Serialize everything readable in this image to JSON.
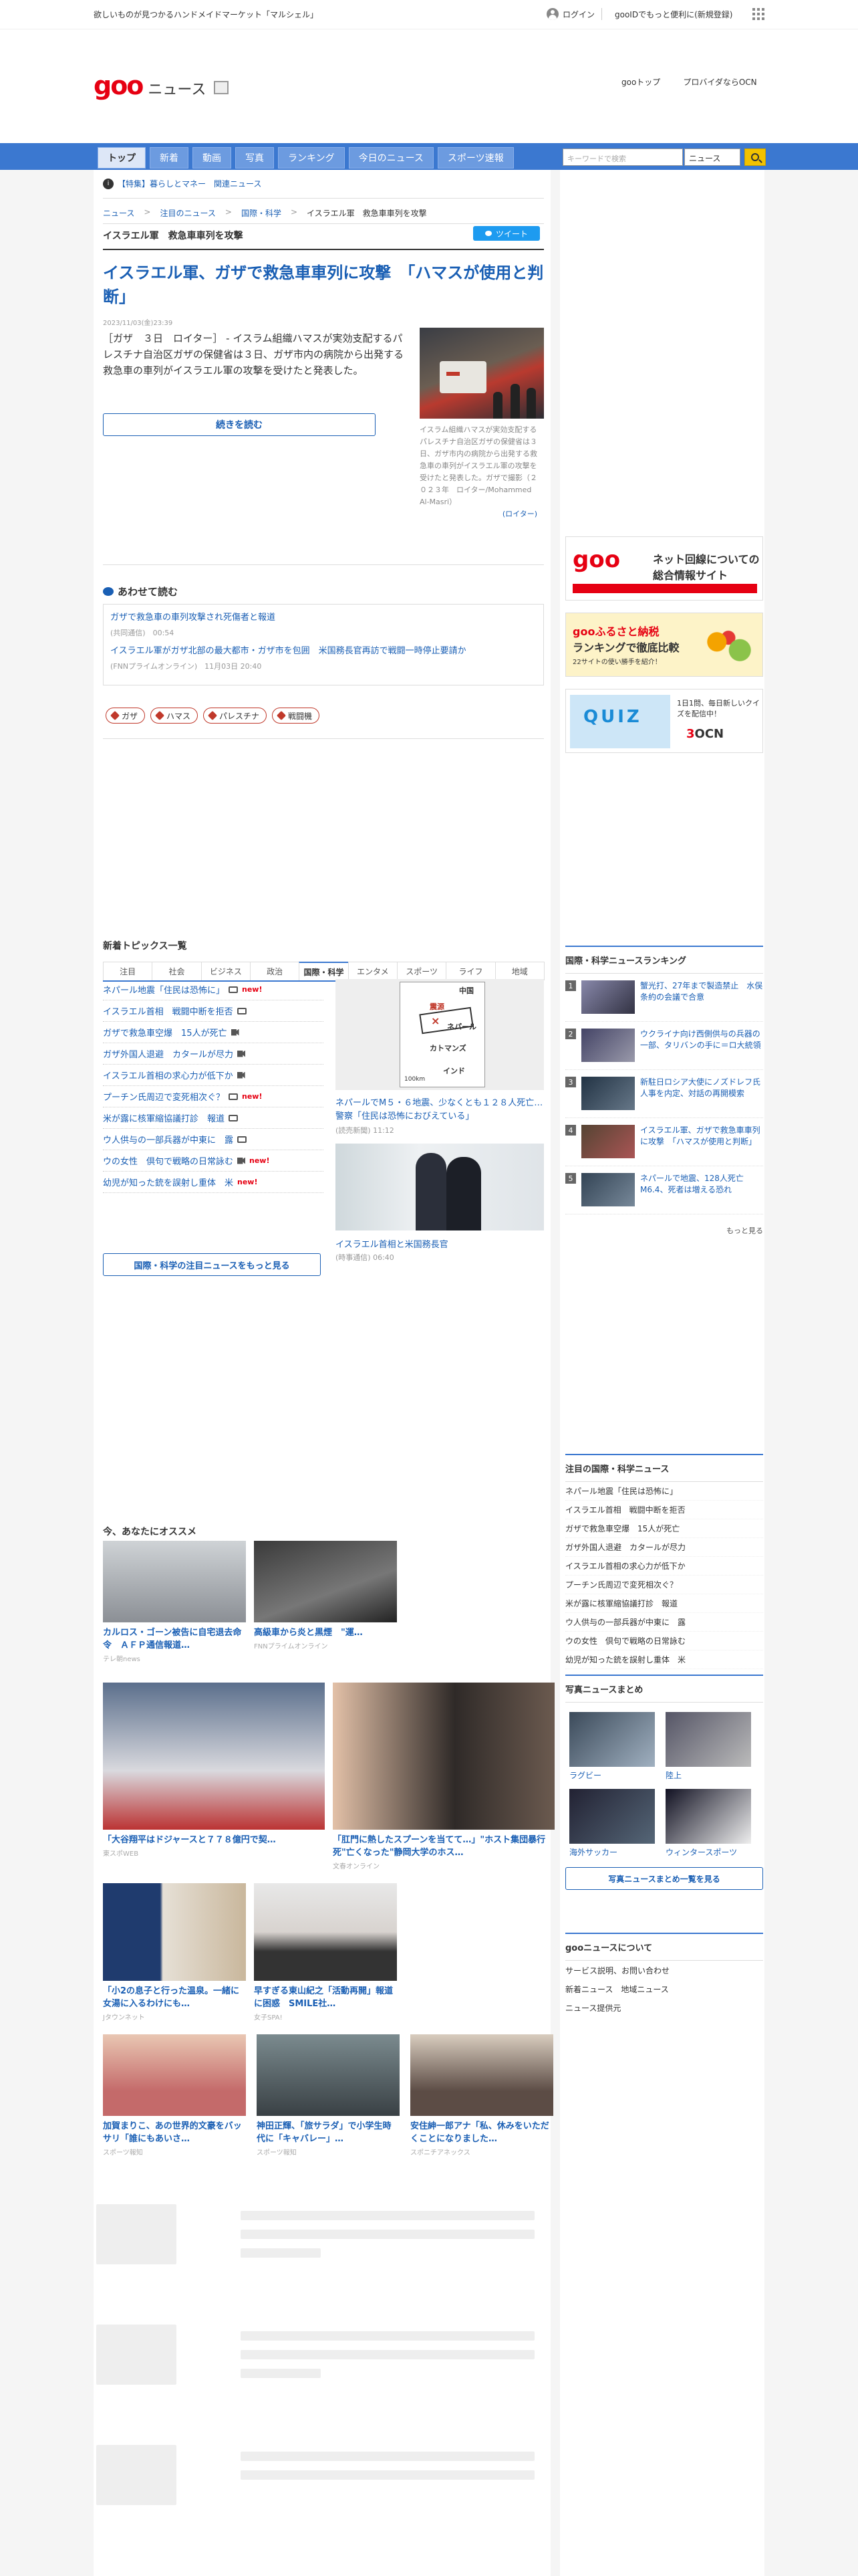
{
  "topbar": {
    "tagline": "欲しいものが見つかるハンドメイドマーケット「マルシェル」",
    "login": "ログイン",
    "promo": "gooIDでもっと便利に(新規登録)"
  },
  "header": {
    "logo_goo": "goo",
    "logo_news": "ニュース",
    "links": [
      "gooトップ",
      "プロバイダならOCN"
    ]
  },
  "nav": {
    "tabs": [
      "トップ",
      "新着",
      "動画",
      "写真",
      "ランキング",
      "今日のニュース",
      "スポーツ速報"
    ],
    "active_tab": "トップ",
    "search_placeholder": "キーワードで検索",
    "search_scope": "ニュース"
  },
  "notice": "【特集】暮らしとマネー　関連ニュース",
  "breadcrumb": {
    "items": [
      "ニュース",
      "注目のニュース",
      "国際・科学"
    ],
    "current": "イスラエル軍　救急車車列を攻撃",
    "sep": ">"
  },
  "article": {
    "subtitle": "イスラエル軍　救急車車列を攻撃",
    "tweet": "ツイート",
    "headline": "イスラエル軍、ガザで救急車車列に攻撃　「ハマスが使用と判断」",
    "date": "2023/11/03(金)23:39",
    "lede": "［ガザ　３日　ロイター］ - イスラム組織ハマスが実効支配するパレスチナ自治区ガザの保健省は３日、ガザ市内の病院から出発する救急車の車列がイスラエル軍の攻撃を受けたと発表した。",
    "readmore": "続きを読む",
    "photo_caption": "イスラム組織ハマスが実効支配するパレスチナ自治区ガザの保健省は３日、ガザ市内の病院から出発する救急車の車列がイスラエル軍の攻撃を受けたと発表した。ガザで撮影（２０２３年　ロイター/Mohammed Al-Masri）",
    "photo_source": "(ロイター)"
  },
  "related": {
    "title": "あわせて読む",
    "items": [
      {
        "title": "ガザで救急車の車列攻撃され死傷者と報道",
        "meta": "(共同通信)　00:54"
      },
      {
        "title": "イスラエル軍がガザ北部の最大都市・ガザ市を包囲　米国務長官再訪で戦闘一時停止要請か",
        "meta": "(FNNプライムオンライン)　11月03日 20:40"
      }
    ],
    "tags": [
      "ガザ",
      "ハマス",
      "パレスチナ",
      "戦闘機"
    ]
  },
  "topics": {
    "title": "新着トピックス一覧",
    "tabs": [
      "注目",
      "社会",
      "ビジネス",
      "政治",
      "国際・科学",
      "エンタメ",
      "スポーツ",
      "ライフ",
      "地域"
    ],
    "active_tab": "国際・科学",
    "items": [
      {
        "text": "ネパール地震「住民は恐怖に」",
        "icon": "camera-icon",
        "new": "new!"
      },
      {
        "text": "イスラエル首相　戦闘中断を拒否",
        "icon": "camera-icon",
        "new": ""
      },
      {
        "text": "ガザで救急車空爆　15人が死亡",
        "icon": "video-icon",
        "new": ""
      },
      {
        "text": "ガザ外国人退避　カタールが尽力",
        "icon": "video-icon",
        "new": ""
      },
      {
        "text": "イスラエル首相の求心力が低下か",
        "icon": "video-icon",
        "new": ""
      },
      {
        "text": "プーチン氏周辺で変死相次ぐ？",
        "icon": "camera-icon",
        "new": "new!"
      },
      {
        "text": "米が露に核軍縮協議打診　報道",
        "icon": "camera-icon",
        "new": ""
      },
      {
        "text": "ウ人供与の一部兵器が中東に　露",
        "icon": "camera-icon",
        "new": ""
      },
      {
        "text": "ウの女性　倶句で戦略の日常詠む",
        "icon": "video-icon",
        "new": "new!"
      },
      {
        "text": "幼児が知った銃を誤射し重体　米",
        "icon": "",
        "new": "new!"
      }
    ],
    "more": "国際・科学の注目ニュースをもっと見る",
    "map_labels": {
      "china": "中国",
      "nepal": "ネパール",
      "epi": "震源",
      "ktm": "カトマンズ",
      "india": "インド",
      "scale": "100km"
    },
    "map_caption": "ネパールでM５・６地震、少なくとも１２８人死亡…警察「住民は恐怖におびえている」",
    "map_meta": "(読売新聞) 11:12",
    "pic2_caption": "イスラエル首相と米国務長官",
    "pic2_meta": "(時事通信) 06:40"
  },
  "recommend": {
    "title": "今、あなたにオススメ",
    "cards": [
      {
        "title": "カルロス・ゴーン被告に自宅退去命令　ＡＦＰ通信報道…",
        "source": "テレ朝news"
      },
      {
        "title": "高級車から炎と黒煙　\"運…",
        "source": "FNNプライムオンライン"
      },
      {
        "title": "「大谷翔平はドジャースと７７８億円で契…",
        "source": "東スポWEB"
      },
      {
        "title": "「肛門に熱したスプーンを当てて…」\"ホスト集団暴行死\"亡くなった\"静岡大学のホス…",
        "source": "文春オンライン"
      },
      {
        "title": "「小2の息子と行った温泉。一緒に女湯に入るわけにも…",
        "source": "Jタウンネット"
      },
      {
        "title": "早すぎる東山紀之「活動再開」報道に困惑　SMILE社…",
        "source": "女子SPA!"
      },
      {
        "title": "加賀まりこ、あの世界的文豪をバッサリ「誰にもあいさ…",
        "source": "スポーツ報知"
      },
      {
        "title": "神田正輝、「旅サラダ」で小学生時代に「キャバレー」…",
        "source": "スポーツ報知"
      },
      {
        "title": "安住紳一郎アナ「私、休みをいただくことになりました…",
        "source": "スポニチアネックス"
      }
    ]
  },
  "sidebar": {
    "ad1": {
      "logo": "goo",
      "line1": "ネット回線についての",
      "line2": "総合情報サイト"
    },
    "ad2": {
      "line1": "gooふるさと納税",
      "line2": "ランキングで徹底比較",
      "line3": "22サイトの使い勝手を紹介！"
    },
    "ad3": {
      "quiz": "QUIZ",
      "line1": "1日1問、毎日新しいクイズを配信中！",
      "ocn": "OCN"
    },
    "ranking": {
      "title": "国際・科学ニュースランキング",
      "items": [
        "蟹光打、27年まで製造禁止　水俣条約の会議で合意",
        "ウクライナ向け西側供与の兵器の一部、タリバンの手に＝ロ大統領",
        "新駐日ロシア大使にノズドレフ氏　人事を内定、対話の再開模索",
        "イスラエル軍、ガザで救急車車列に攻撃　「ハマスが使用と判断」",
        "ネパールで地震、128人死亡　M6.4、死者は増える恐れ"
      ],
      "more": "もっと見る"
    },
    "attention": {
      "title": "注目の国際・科学ニュース",
      "items": [
        "ネパール地震「住民は恐怖に」",
        "イスラエル首相　戦闘中断を拒否",
        "ガザで救急車空爆　15人が死亡",
        "ガザ外国人退避　カタールが尽力",
        "イスラエル首相の求心力が低下か",
        "プーチン氏周辺で変死相次ぐ？",
        "米が露に核軍縮協議打診　報道",
        "ウ人供与の一部兵器が中東に　露",
        "ウの女性　倶句で戦略の日常詠む",
        "幼児が知った銃を誤射し重体　米"
      ]
    },
    "photos": {
      "title": "写真ニュースまとめ",
      "items": [
        "ラグビー",
        "陸上",
        "海外サッカー",
        "ウィンタースポーツ"
      ],
      "button": "写真ニュースまとめ一覧を見る"
    },
    "about": {
      "title": "gooニュースについて",
      "items": [
        "サービス説明、お問い合わせ",
        "新着ニュース　地域ニュース",
        "ニュース提供元"
      ]
    }
  }
}
